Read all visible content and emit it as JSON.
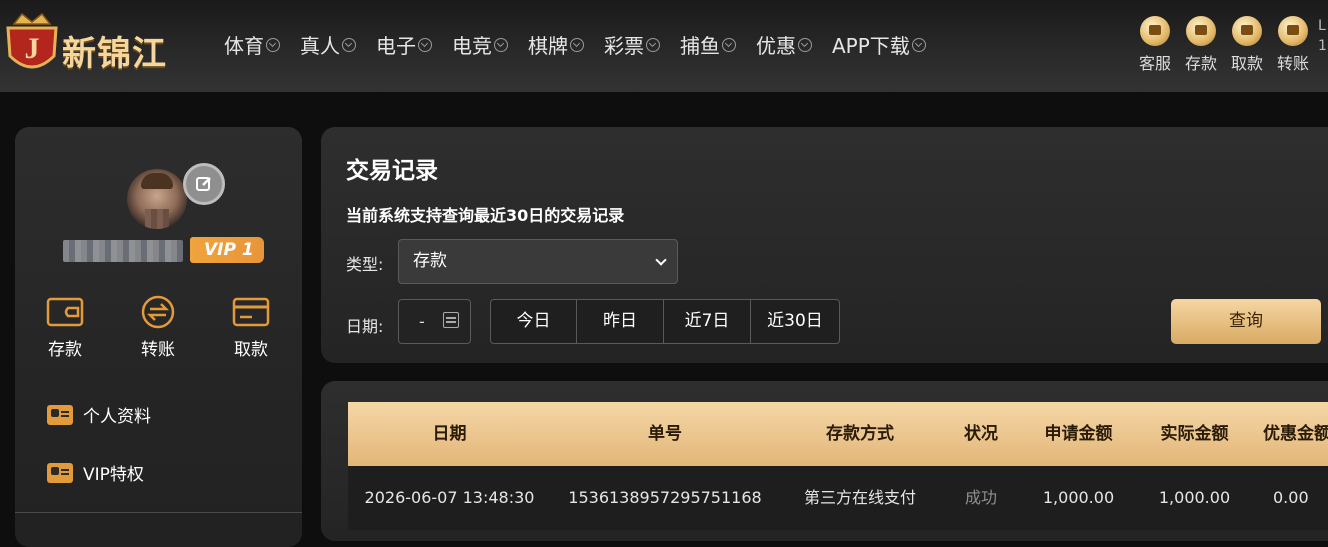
{
  "header": {
    "brand": "新锦江",
    "nav": [
      {
        "label": "体育"
      },
      {
        "label": "真人"
      },
      {
        "label": "电子"
      },
      {
        "label": "电竞"
      },
      {
        "label": "棋牌"
      },
      {
        "label": "彩票"
      },
      {
        "label": "捕鱼"
      },
      {
        "label": "优惠"
      },
      {
        "label": "APP下载"
      }
    ],
    "quick_links": [
      {
        "label": "客服",
        "icon": "customer-service-icon"
      },
      {
        "label": "存款",
        "icon": "wallet-icon"
      },
      {
        "label": "取款",
        "icon": "withdraw-icon"
      },
      {
        "label": "转账",
        "icon": "transfer-icon"
      }
    ],
    "edge_glyphs": [
      "L",
      "1"
    ]
  },
  "sidebar": {
    "vip_label": "VIP 1",
    "actions": [
      {
        "label": "存款",
        "icon": "wallet-icon"
      },
      {
        "label": "转账",
        "icon": "transfer-icon"
      },
      {
        "label": "取款",
        "icon": "card-icon"
      }
    ],
    "menu": [
      {
        "label": "个人资料",
        "icon": "id-card-icon"
      },
      {
        "label": "VIP特权",
        "icon": "id-card-icon"
      }
    ]
  },
  "filter": {
    "title": "交易记录",
    "subtitle": "当前系统支持查询最近30日的交易记录",
    "type_label": "类型:",
    "type_value": "存款",
    "date_label": "日期:",
    "date_value": "-",
    "ranges": [
      "今日",
      "昨日",
      "近7日",
      "近30日"
    ],
    "query_label": "查询"
  },
  "table": {
    "columns": [
      "日期",
      "单号",
      "存款方式",
      "状况",
      "申请金额",
      "实际金额",
      "优惠金额"
    ],
    "rows": [
      [
        "2026-06-07 13:48:30",
        "1536138957295751168",
        "第三方在线支付",
        "成功",
        "1,000.00",
        "1,000.00",
        "0.00"
      ]
    ]
  }
}
